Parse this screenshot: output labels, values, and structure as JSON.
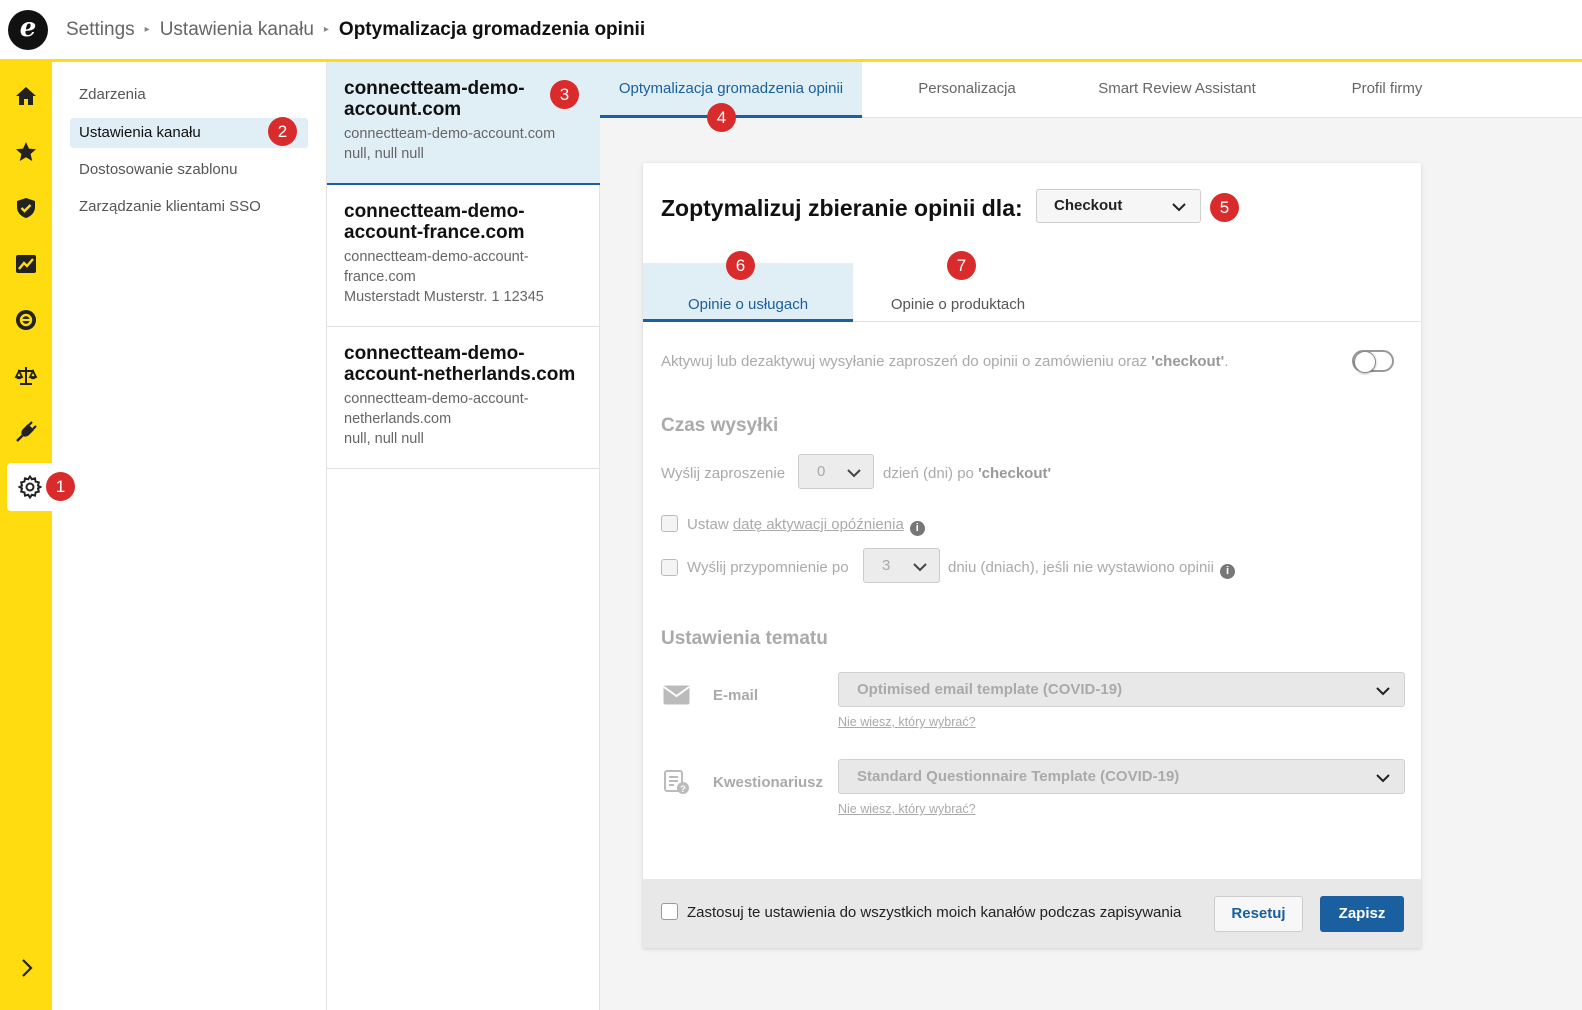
{
  "header": {
    "logo_letter": "e",
    "breadcrumbs": [
      "Settings",
      "Ustawienia kanału",
      "Optymalizacja gromadzenia opinii"
    ]
  },
  "rail": {
    "items": [
      "home-icon",
      "star-icon",
      "shield-icon",
      "chart-icon",
      "trusted-logo-icon",
      "scales-icon",
      "plug-icon",
      "gear-icon",
      "chevron-right-icon"
    ],
    "active": "gear-icon",
    "background": "#ffdc0f"
  },
  "nav": {
    "items": [
      {
        "label": "Zdarzenia"
      },
      {
        "label": "Ustawienia kanału"
      },
      {
        "label": "Dostosowanie szablonu"
      },
      {
        "label": "Zarządzanie klientami SSO"
      }
    ],
    "active_index": 1
  },
  "channels": [
    {
      "name": "connectteam-demo-account.com",
      "url": "connectteam-demo-account.com",
      "address": "null, null null"
    },
    {
      "name": "connectteam-demo-account-france.com",
      "url": "connectteam-demo-account-france.com",
      "address": "Musterstadt Musterstr. 1 12345"
    },
    {
      "name": "connectteam-demo-account-netherlands.com",
      "url": "connectteam-demo-account-netherlands.com",
      "address": "null, null null"
    }
  ],
  "tabs": [
    {
      "label": "Optymalizacja gromadzenia opinii",
      "active": true
    },
    {
      "label": "Personalizacja"
    },
    {
      "label": "Smart Review Assistant"
    },
    {
      "label": "Profil firmy"
    }
  ],
  "card": {
    "title": "Zoptymalizuj zbieranie opinii dla:",
    "select_value": "Checkout",
    "subtabs": [
      {
        "label": "Opinie o usługach",
        "active": true
      },
      {
        "label": "Opinie o produktach"
      }
    ],
    "activation": {
      "text_before": "Aktywuj lub dezaktywuj wysyłanie zaproszeń do opinii o zamówieniu oraz ",
      "text_bold": "'checkout'",
      "text_after": ".",
      "enabled": false
    },
    "send_time": {
      "heading": "Czas wysyłki",
      "send_label": "Wyślij zaproszenie",
      "days_value": "0",
      "after_text": "dzień (dni) po ",
      "after_bold": "'checkout'",
      "delay_label_prefix": "Ustaw ",
      "delay_link": "datę aktywacji opóźnienia",
      "reminder_label": "Wyślij przypomnienie po",
      "reminder_value": "3",
      "reminder_after": "dniu (dniach), jeśli nie wystawiono opinii"
    },
    "templates": {
      "heading": "Ustawienia tematu",
      "email_label": "E-mail",
      "email_value": "Optimised email template (COVID-19)",
      "questionnaire_label": "Kwestionariusz",
      "questionnaire_value": "Standard Questionnaire Template (COVID-19)",
      "help_link": "Nie wiesz, który wybrać?"
    },
    "footer": {
      "apply_all_label": "Zastosuj te ustawienia do wszystkich moich kanałów podczas zapisywania",
      "reset_label": "Resetuj",
      "save_label": "Zapisz"
    }
  },
  "markers": [
    "1",
    "2",
    "3",
    "4",
    "5",
    "6",
    "7"
  ],
  "colors": {
    "accent": "#1a5fa0",
    "brand_yellow": "#ffdc0f",
    "marker_red": "#d92b2b",
    "active_bg": "#e0eef6"
  }
}
